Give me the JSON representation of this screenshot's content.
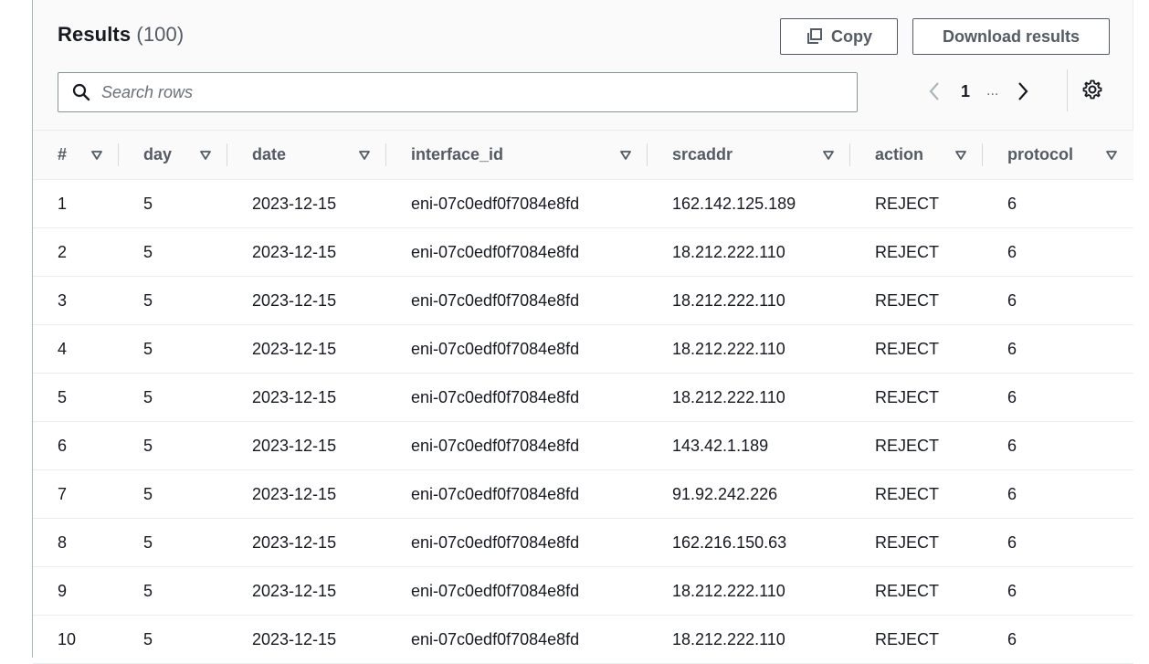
{
  "results": {
    "title": "Results",
    "count": "(100)"
  },
  "buttons": {
    "copy_label": "Copy",
    "download_label": "Download results"
  },
  "search": {
    "placeholder": "Search rows",
    "value": ""
  },
  "pagination": {
    "current_page": "1",
    "ellipsis": "..."
  },
  "icons": {
    "copy": "copy-icon",
    "search": "search-icon",
    "prev": "chevron-left-icon",
    "next": "chevron-right-icon",
    "settings": "gear-icon",
    "sort": "sort-down-triangle-icon"
  },
  "table": {
    "columns": [
      "#",
      "day",
      "date",
      "interface_id",
      "srcaddr",
      "action",
      "protocol"
    ],
    "rows": [
      [
        "1",
        "5",
        "2023-12-15",
        "eni-07c0edf0f7084e8fd",
        "162.142.125.189",
        "REJECT",
        "6"
      ],
      [
        "2",
        "5",
        "2023-12-15",
        "eni-07c0edf0f7084e8fd",
        "18.212.222.110",
        "REJECT",
        "6"
      ],
      [
        "3",
        "5",
        "2023-12-15",
        "eni-07c0edf0f7084e8fd",
        "18.212.222.110",
        "REJECT",
        "6"
      ],
      [
        "4",
        "5",
        "2023-12-15",
        "eni-07c0edf0f7084e8fd",
        "18.212.222.110",
        "REJECT",
        "6"
      ],
      [
        "5",
        "5",
        "2023-12-15",
        "eni-07c0edf0f7084e8fd",
        "18.212.222.110",
        "REJECT",
        "6"
      ],
      [
        "6",
        "5",
        "2023-12-15",
        "eni-07c0edf0f7084e8fd",
        "143.42.1.189",
        "REJECT",
        "6"
      ],
      [
        "7",
        "5",
        "2023-12-15",
        "eni-07c0edf0f7084e8fd",
        "91.92.242.226",
        "REJECT",
        "6"
      ],
      [
        "8",
        "5",
        "2023-12-15",
        "eni-07c0edf0f7084e8fd",
        "162.216.150.63",
        "REJECT",
        "6"
      ],
      [
        "9",
        "5",
        "2023-12-15",
        "eni-07c0edf0f7084e8fd",
        "18.212.222.110",
        "REJECT",
        "6"
      ],
      [
        "10",
        "5",
        "2023-12-15",
        "eni-07c0edf0f7084e8fd",
        "18.212.222.110",
        "REJECT",
        "6"
      ]
    ]
  },
  "colors": {
    "text": "#16191f",
    "secondary_text": "#545b64",
    "border": "#eaeded",
    "header_bg": "#fafafa"
  }
}
